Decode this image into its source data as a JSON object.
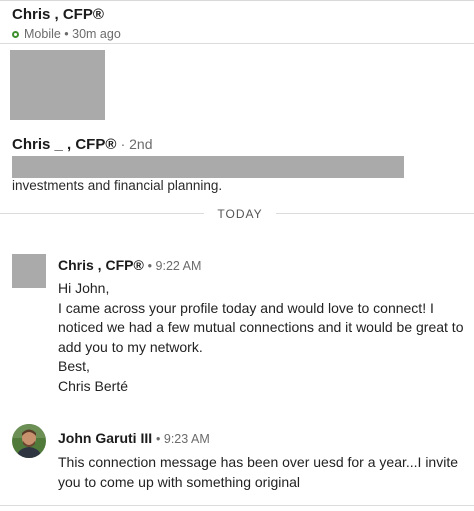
{
  "header": {
    "name": "Chris        , CFP®",
    "status": "Mobile • 30m ago",
    "status_color": "#3f8f2f"
  },
  "profile": {
    "name": "Chris _      , CFP®",
    "degree": "· 2nd",
    "headline": "investments and financial planning."
  },
  "date_divider": "TODAY",
  "messages": [
    {
      "sender": "Chris        , CFP®",
      "time": "• 9:22 AM",
      "lines": [
        "Hi John,",
        "I came across your profile today and would love to connect! I",
        "noticed we had a few mutual connections and it would be great to",
        "add you to my network.",
        "Best,",
        "Chris Berté"
      ]
    },
    {
      "sender": "John Garuti III",
      "time": "• 9:23 AM",
      "lines": [
        "This connection message has been over uesd for a year...I invite",
        "you to come up with something original"
      ]
    }
  ]
}
